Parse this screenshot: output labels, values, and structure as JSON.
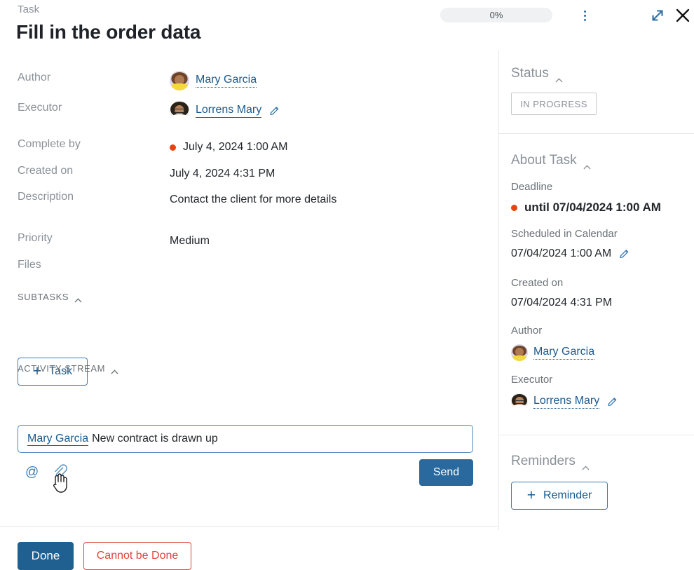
{
  "header": {
    "eyebrow": "Task",
    "title": "Fill in the order data",
    "progress": "0%",
    "kebab_icon": "kebab-menu-icon",
    "expand_icon": "expand-icon",
    "close_icon": "close-icon"
  },
  "main": {
    "fields": [
      {
        "label": "Author",
        "value": "Mary Garcia"
      },
      {
        "label": "Executor",
        "value": "Lorrens Mary"
      },
      {
        "label": "Complete by",
        "value": "July 4, 2024 1:00 AM"
      },
      {
        "label": "Created on",
        "value": "July 4, 2024 4:31 PM"
      },
      {
        "label": "Description",
        "value": "Contact the client for more details"
      },
      {
        "label": "Priority",
        "value": "Medium"
      },
      {
        "label": "Files",
        "value": ""
      }
    ],
    "subtasks": {
      "heading": "SUBTASKS",
      "add_button": "Task"
    },
    "activity": {
      "heading": "ACTIVITY STREAM",
      "comment_mention": "Mary Garcia",
      "comment_text": "New contract is drawn up",
      "mention_icon": "at-mention-icon",
      "attach_icon": "paperclip-icon",
      "send_button": "Send"
    },
    "footer": {
      "done_button": "Done",
      "cannot_button": "Cannot be Done"
    }
  },
  "sidebar": {
    "status": {
      "heading": "Status",
      "badge": "IN PROGRESS"
    },
    "about": {
      "heading": "About Task",
      "deadline_label": "Deadline",
      "deadline_value": "until 07/04/2024 1:00 AM",
      "scheduled_label": "Scheduled in Calendar",
      "scheduled_value": "07/04/2024 1:00 AM",
      "created_label": "Created on",
      "created_value": "07/04/2024 4:31 PM",
      "author_label": "Author",
      "author_value": "Mary Garcia",
      "executor_label": "Executor",
      "executor_value": "Lorrens Mary"
    },
    "reminders": {
      "heading": "Reminders",
      "add_button": "Reminder"
    }
  },
  "colors": {
    "accent_blue": "#1a5a8e",
    "button_blue": "#29699e",
    "danger_red": "#e2443d",
    "deadline_dot": "#e8420f",
    "muted_text": "#8a9199"
  }
}
